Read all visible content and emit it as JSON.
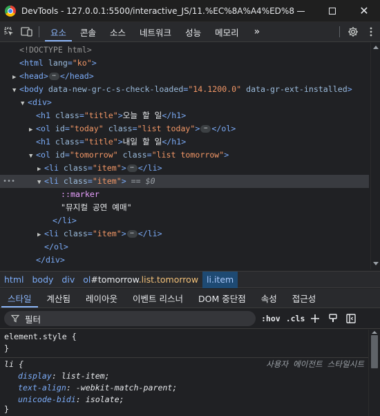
{
  "window": {
    "title": "DevTools - 127.0.0.1:5500/interactive_JS/11.%EC%8A%A4%ED%83%8..."
  },
  "toolbar": {
    "tabs": [
      "요소",
      "콘솔",
      "소스",
      "네트워크",
      "성능",
      "메모리"
    ],
    "active_tab": "요소",
    "more_label": "»"
  },
  "elements": {
    "lines": [
      {
        "indent": 1,
        "tri": "",
        "parts": [
          [
            "doctype",
            "<!DOCTYPE html>"
          ]
        ]
      },
      {
        "indent": 1,
        "tri": "",
        "parts": [
          [
            "tag",
            "<html "
          ],
          [
            "attrn",
            "lang"
          ],
          [
            "tag",
            "="
          ],
          [
            "attrv",
            "\"ko\""
          ],
          [
            "tag",
            ">"
          ]
        ]
      },
      {
        "indent": 1,
        "tri": "▶",
        "parts": [
          [
            "tag",
            "<head>"
          ],
          [
            "ellip",
            "⋯"
          ],
          [
            "tag",
            "</head>"
          ]
        ]
      },
      {
        "indent": 1,
        "tri": "▼",
        "parts": [
          [
            "tag",
            "<body "
          ],
          [
            "attrn",
            "data-new-gr-c-s-check-loaded"
          ],
          [
            "tag",
            "="
          ],
          [
            "attrv",
            "\"14.1200.0\""
          ],
          [
            "tag",
            " "
          ],
          [
            "attrn",
            "data-gr-ext-installed"
          ],
          [
            "tag",
            ">"
          ]
        ]
      },
      {
        "indent": 2,
        "tri": "▼",
        "parts": [
          [
            "tag",
            "<div>"
          ]
        ]
      },
      {
        "indent": 3,
        "tri": "",
        "parts": [
          [
            "tag",
            "<h1 "
          ],
          [
            "attrn",
            "class"
          ],
          [
            "tag",
            "="
          ],
          [
            "attrv",
            "\"title\""
          ],
          [
            "tag",
            ">"
          ],
          [
            "txt",
            "오늘 할 일"
          ],
          [
            "tag",
            "</h1>"
          ]
        ]
      },
      {
        "indent": 3,
        "tri": "▶",
        "parts": [
          [
            "tag",
            "<ol "
          ],
          [
            "attrn",
            "id"
          ],
          [
            "tag",
            "="
          ],
          [
            "attrv",
            "\"today\""
          ],
          [
            "tag",
            " "
          ],
          [
            "attrn",
            "class"
          ],
          [
            "tag",
            "="
          ],
          [
            "attrv",
            "\"list today\""
          ],
          [
            "tag",
            ">"
          ],
          [
            "ellip",
            "⋯"
          ],
          [
            "tag",
            "</ol>"
          ]
        ]
      },
      {
        "indent": 3,
        "tri": "",
        "parts": [
          [
            "tag",
            "<h1 "
          ],
          [
            "attrn",
            "class"
          ],
          [
            "tag",
            "="
          ],
          [
            "attrv",
            "\"title\""
          ],
          [
            "tag",
            ">"
          ],
          [
            "txt",
            "내일 할 일"
          ],
          [
            "tag",
            "</h1>"
          ]
        ]
      },
      {
        "indent": 3,
        "tri": "▼",
        "parts": [
          [
            "tag",
            "<ol "
          ],
          [
            "attrn",
            "id"
          ],
          [
            "tag",
            "="
          ],
          [
            "attrv",
            "\"tomorrow\""
          ],
          [
            "tag",
            " "
          ],
          [
            "attrn",
            "class"
          ],
          [
            "tag",
            "="
          ],
          [
            "attrv",
            "\"list tomorrow\""
          ],
          [
            "tag",
            ">"
          ]
        ]
      },
      {
        "indent": 4,
        "tri": "▶",
        "parts": [
          [
            "tag",
            "<li "
          ],
          [
            "attrn",
            "class"
          ],
          [
            "tag",
            "="
          ],
          [
            "attrv",
            "\"item\""
          ],
          [
            "tag",
            ">"
          ],
          [
            "ellip",
            "⋯"
          ],
          [
            "tag",
            "</li>"
          ]
        ]
      },
      {
        "indent": 4,
        "tri": "▼",
        "selected": true,
        "parts": [
          [
            "tag",
            "<li "
          ],
          [
            "attrn",
            "class"
          ],
          [
            "tag",
            "="
          ],
          [
            "attrv",
            "\"item\""
          ],
          [
            "tag",
            ">"
          ],
          [
            "eq0",
            " == $0"
          ]
        ]
      },
      {
        "indent": 6,
        "tri": "",
        "parts": [
          [
            "marker",
            "::marker"
          ]
        ]
      },
      {
        "indent": 6,
        "tri": "",
        "parts": [
          [
            "txt",
            "\"뮤지컬 공연 예매\""
          ]
        ]
      },
      {
        "indent": 5,
        "tri": "",
        "parts": [
          [
            "tag",
            "</li>"
          ]
        ]
      },
      {
        "indent": 4,
        "tri": "▶",
        "parts": [
          [
            "tag",
            "<li "
          ],
          [
            "attrn",
            "class"
          ],
          [
            "tag",
            "="
          ],
          [
            "attrv",
            "\"item\""
          ],
          [
            "tag",
            ">"
          ],
          [
            "ellip",
            "⋯"
          ],
          [
            "tag",
            "</li>"
          ]
        ]
      },
      {
        "indent": 4,
        "tri": "",
        "parts": [
          [
            "tag",
            "</ol>"
          ]
        ]
      },
      {
        "indent": 3,
        "tri": "",
        "parts": [
          [
            "tag",
            "</div>"
          ]
        ]
      }
    ],
    "gutter_dots": "•••"
  },
  "breadcrumb": {
    "items": [
      {
        "tag": "html",
        "id": "",
        "cls": ""
      },
      {
        "tag": "body",
        "id": "",
        "cls": ""
      },
      {
        "tag": "div",
        "id": "",
        "cls": ""
      },
      {
        "tag": "ol",
        "id": "#tomorrow",
        "cls": ".list.tomorrow"
      },
      {
        "tag": "li",
        "id": "",
        "cls": ".item",
        "active": true
      }
    ]
  },
  "styles_tabs": {
    "tabs": [
      "스타일",
      "계산됨",
      "레이아웃",
      "이벤트 리스너",
      "DOM 중단점",
      "속성",
      "접근성"
    ],
    "active_tab": "스타일"
  },
  "filter": {
    "placeholder": "필터",
    "hov_label": ":hov",
    "cls_label": ".cls"
  },
  "styles": {
    "element_style_open": "element.style {",
    "element_style_close": "}",
    "rule_selector": "li {",
    "rule_source": "사용자 에이전트 스타일시트",
    "props": [
      {
        "name": "display",
        "value": "list-item;"
      },
      {
        "name": "text-align",
        "value": "-webkit-match-parent;"
      },
      {
        "name": "unicode-bidi",
        "value": "isolate;"
      }
    ],
    "rule_close": "}"
  },
  "colors": {
    "accent": "#8ab4f8",
    "tag": "#7cacf8",
    "attr_value": "#f29766",
    "selected_row": "#393b40",
    "active_crumb": "#1e4a73"
  }
}
